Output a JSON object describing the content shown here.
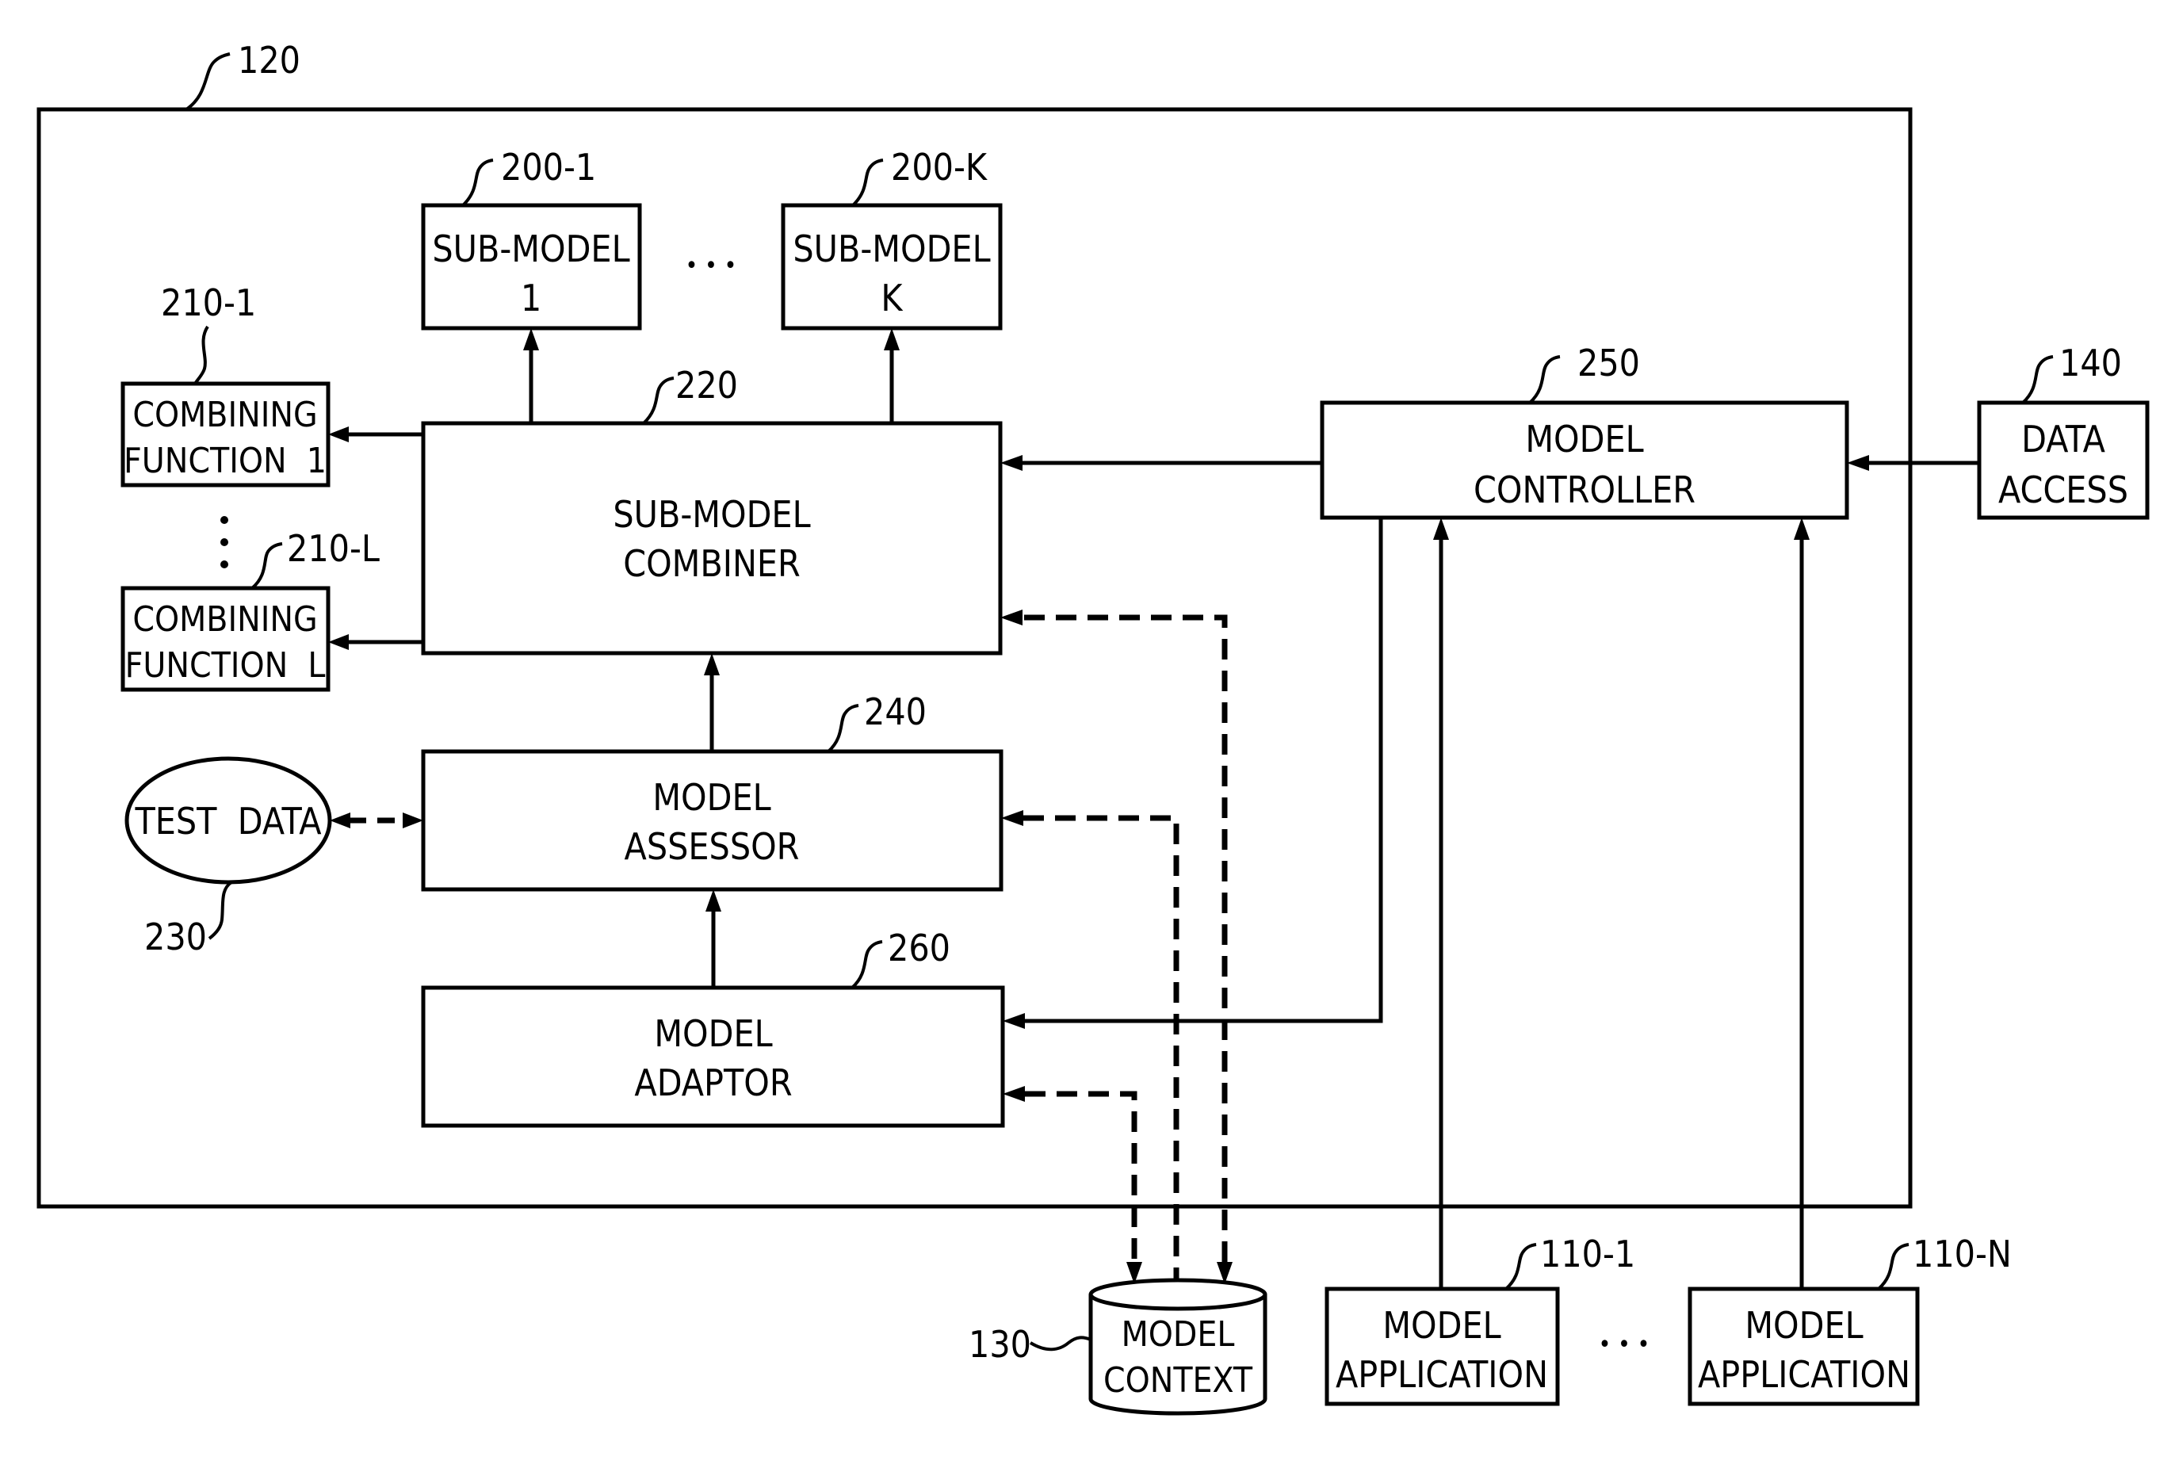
{
  "figure": {
    "system": {
      "ref": "120"
    },
    "sub_models": [
      {
        "ref": "200-1",
        "line1": "SUB-MODEL",
        "line2": "1"
      },
      {
        "ref": "200-K",
        "line1": "SUB-MODEL",
        "line2": "K"
      }
    ],
    "sub_model_ellipsis": "• • •",
    "combining_functions": [
      {
        "ref": "210-1",
        "line1": "COMBINING",
        "line2": "FUNCTION  1"
      },
      {
        "ref": "210-L",
        "line1": "COMBINING",
        "line2": "FUNCTION  L"
      }
    ],
    "combiner": {
      "ref": "220",
      "line1": "SUB-MODEL",
      "line2": "COMBINER"
    },
    "test_data": {
      "ref": "230",
      "label": "TEST  DATA"
    },
    "assessor": {
      "ref": "240",
      "line1": "MODEL",
      "line2": "ASSESSOR"
    },
    "controller": {
      "ref": "250",
      "line1": "MODEL",
      "line2": "CONTROLLER"
    },
    "adaptor": {
      "ref": "260",
      "line1": "MODEL",
      "line2": "ADAPTOR"
    },
    "data_access": {
      "ref": "140",
      "line1": "DATA",
      "line2": "ACCESS"
    },
    "model_context": {
      "ref": "130",
      "line1": "MODEL",
      "line2": "CONTEXT"
    },
    "model_applications": [
      {
        "ref": "110-1",
        "line1": "MODEL",
        "line2": "APPLICATION"
      },
      {
        "ref": "110-N",
        "line1": "MODEL",
        "line2": "APPLICATION"
      }
    ],
    "application_ellipsis": "• • •"
  }
}
